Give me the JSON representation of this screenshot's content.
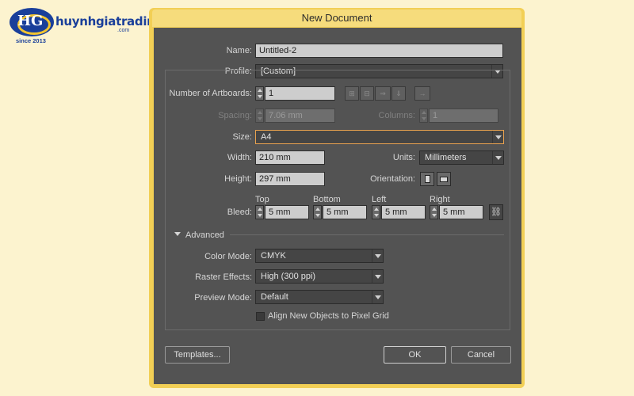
{
  "watermark": {
    "brand": "huynhgiatrading",
    "domain": ".com",
    "since": "since 2013",
    "letters": "HG"
  },
  "dialog": {
    "title": "New Document",
    "name": {
      "label": "Name:",
      "value": "Untitled-2"
    },
    "profile": {
      "label": "Profile:",
      "value": "[Custom]"
    },
    "artboards": {
      "label": "Number of Artboards:",
      "value": "1"
    },
    "spacing": {
      "label": "Spacing:",
      "value": "7.06 mm"
    },
    "columns": {
      "label": "Columns:",
      "value": "1"
    },
    "size": {
      "label": "Size:",
      "value": "A4"
    },
    "width": {
      "label": "Width:",
      "value": "210 mm"
    },
    "units": {
      "label": "Units:",
      "value": "Millimeters"
    },
    "height": {
      "label": "Height:",
      "value": "297 mm"
    },
    "orientation": {
      "label": "Orientation:"
    },
    "bleed": {
      "label": "Bleed:",
      "top": {
        "label": "Top",
        "value": "5 mm"
      },
      "bottom": {
        "label": "Bottom",
        "value": "5 mm"
      },
      "left": {
        "label": "Left",
        "value": "5 mm"
      },
      "right": {
        "label": "Right",
        "value": "5 mm"
      }
    },
    "advanced": {
      "label": "Advanced",
      "color_mode": {
        "label": "Color Mode:",
        "value": "CMYK"
      },
      "raster_effects": {
        "label": "Raster Effects:",
        "value": "High (300 ppi)"
      },
      "preview_mode": {
        "label": "Preview Mode:",
        "value": "Default"
      },
      "align_pixel_grid": {
        "label": "Align New Objects to Pixel Grid",
        "checked": false
      }
    },
    "buttons": {
      "templates": "Templates...",
      "ok": "OK",
      "cancel": "Cancel"
    },
    "arrange_icons": [
      "grid-by-row-icon",
      "grid-by-column-icon",
      "arrange-by-row-icon",
      "arrange-by-column-icon",
      "right-to-left-icon"
    ]
  },
  "colors": {
    "window_frame": "#f2cf55",
    "dialog_bg": "#535353",
    "focus_border": "#e8a24f",
    "page_bg": "#fcf3cf"
  }
}
